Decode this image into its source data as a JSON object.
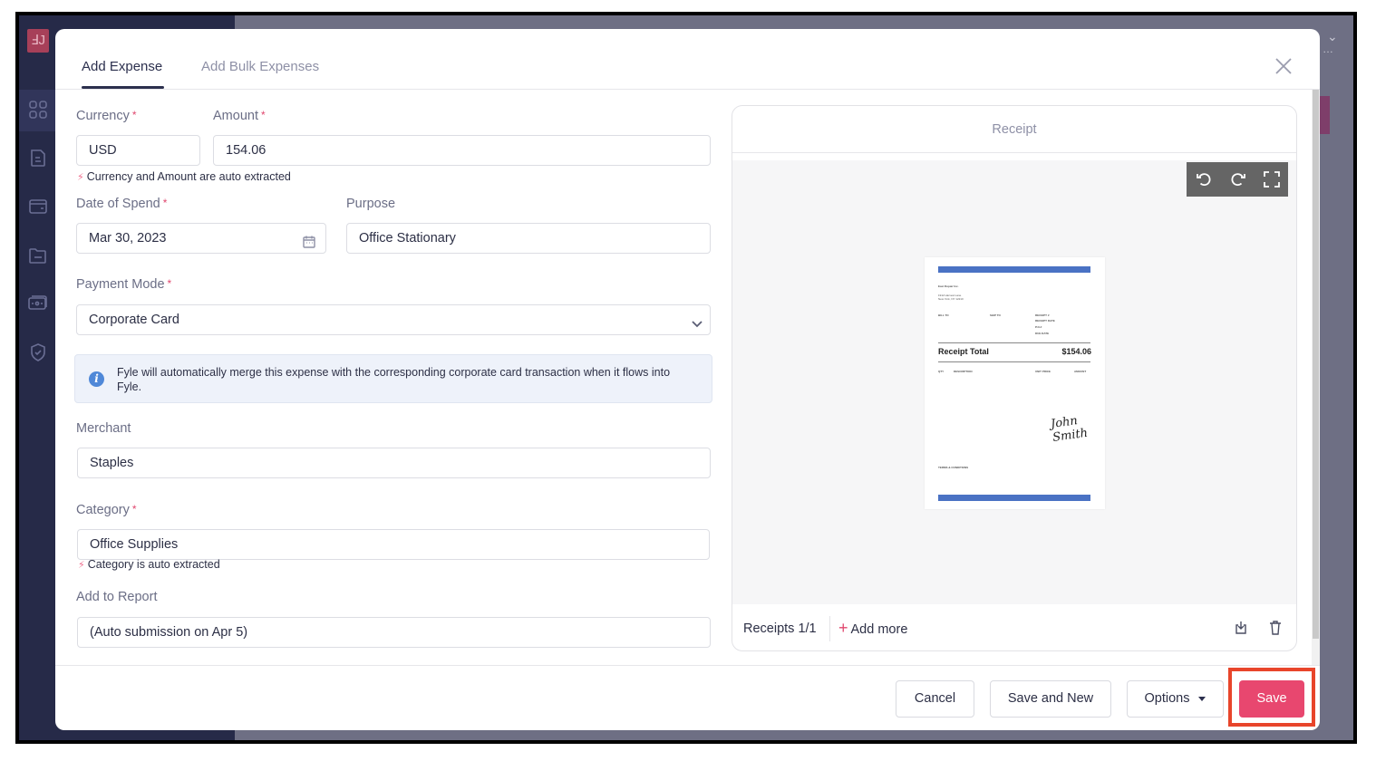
{
  "background": {
    "sidebar_icons": [
      "dashboard-icon",
      "document-icon",
      "card-icon",
      "folder-icon",
      "wallet-icon",
      "shield-check-icon"
    ]
  },
  "modal": {
    "tabs": [
      {
        "label": "Add Expense",
        "active": true
      },
      {
        "label": "Add Bulk Expenses",
        "active": false
      }
    ],
    "close_icon": "close-icon"
  },
  "form": {
    "currency": {
      "label": "Currency",
      "required": "*",
      "value": "USD"
    },
    "amount": {
      "label": "Amount",
      "required": "*",
      "value": "154.06"
    },
    "amount_hint": "Currency and Amount are auto extracted",
    "date_of_spend": {
      "label": "Date of Spend",
      "required": "*",
      "value": "Mar 30, 2023"
    },
    "purpose": {
      "label": "Purpose",
      "value": "Office Stationary"
    },
    "payment_mode": {
      "label": "Payment Mode",
      "required": "*",
      "value": "Corporate Card"
    },
    "info_message": "Fyle will automatically merge this expense with the corresponding corporate card transaction when it flows into Fyle.",
    "merchant": {
      "label": "Merchant",
      "value": "Staples"
    },
    "category": {
      "label": "Category",
      "required": "*",
      "value": "Office Supplies"
    },
    "category_hint": "Category is auto extracted",
    "add_to_report": {
      "label": "Add to Report",
      "value": "(Auto submission on Apr 5)"
    }
  },
  "receipt": {
    "title": "Receipt",
    "document": {
      "company": "East Repair Inc.",
      "total_label": "Receipt Total",
      "total_value": "$154.06",
      "bill_to": "BILL TO",
      "ship_to": "SHIP TO",
      "receipt_no": "RECEIPT #",
      "receipt_date": "RECEIPT DATE",
      "po": "P.O.#",
      "due_date": "DUE DATE",
      "qty": "QTY",
      "description": "DESCRIPTION",
      "unit_price": "UNIT PRICE",
      "amount": "AMOUNT",
      "terms": "TERMS & CONDITIONS",
      "signature": "John Smith"
    },
    "count_label": "Receipts 1/1",
    "add_more_label": "Add more",
    "tools": [
      "rotate-left-icon",
      "rotate-right-icon",
      "fullscreen-icon"
    ]
  },
  "footer": {
    "cancel": "Cancel",
    "save_and_new": "Save and New",
    "options": "Options",
    "save": "Save"
  },
  "colors": {
    "primary": "#e8476f",
    "sidebar": "#262a48",
    "highlight": "#e8452b",
    "info_bg": "#eef2fa"
  }
}
